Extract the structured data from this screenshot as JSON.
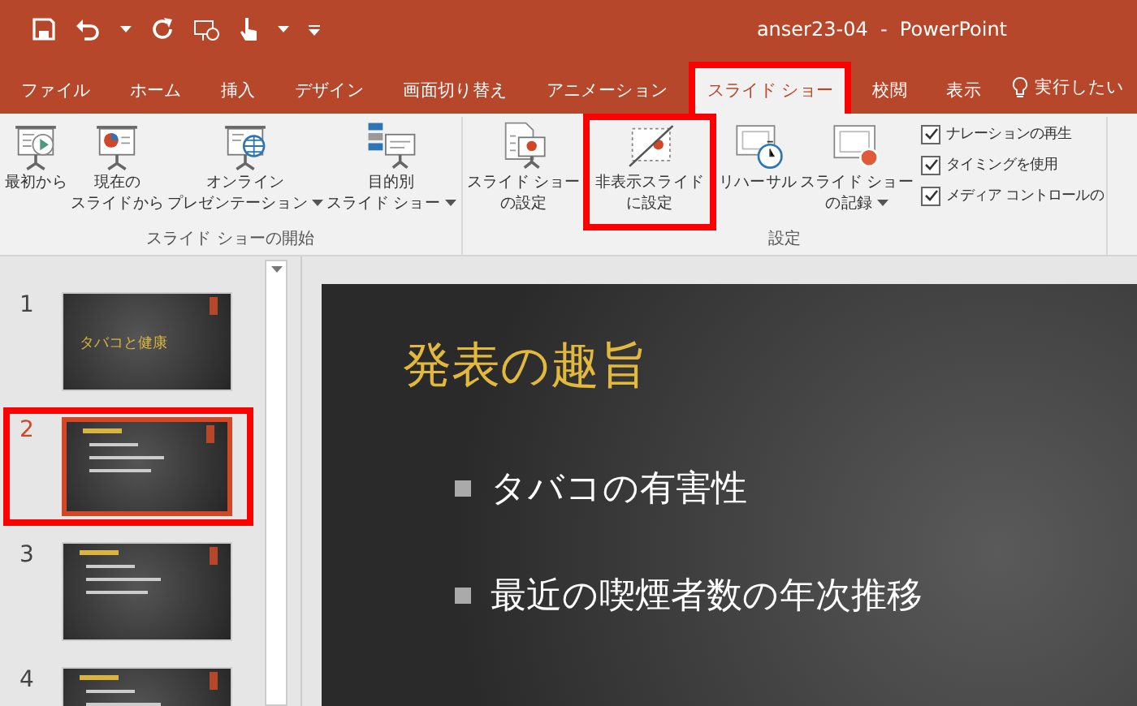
{
  "window": {
    "title": "anser23-04  -  PowerPoint"
  },
  "ribbon_tabs": [
    {
      "label": "ファイル",
      "selected": false,
      "highlighted": false
    },
    {
      "label": "ホーム",
      "selected": false,
      "highlighted": false
    },
    {
      "label": "挿入",
      "selected": false,
      "highlighted": false
    },
    {
      "label": "デザイン",
      "selected": false,
      "highlighted": false
    },
    {
      "label": "画面切り替え",
      "selected": false,
      "highlighted": false
    },
    {
      "label": "アニメーション",
      "selected": false,
      "highlighted": false
    },
    {
      "label": "スライド ショー",
      "selected": true,
      "highlighted": true
    },
    {
      "label": "校閲",
      "selected": false,
      "highlighted": false
    },
    {
      "label": "表示",
      "selected": false,
      "highlighted": false
    }
  ],
  "tell_me": "実行したい",
  "ribbon_groups": [
    {
      "label": "スライド ショーの開始",
      "buttons": [
        {
          "lines": [
            "最初から"
          ],
          "dropdown": false,
          "highlighted": false
        },
        {
          "lines": [
            "現在の",
            "スライドから"
          ],
          "dropdown": false,
          "highlighted": false
        },
        {
          "lines": [
            "オンライン",
            "プレゼンテーション"
          ],
          "dropdown": true,
          "highlighted": false
        },
        {
          "lines": [
            "目的別",
            "スライド ショー"
          ],
          "dropdown": true,
          "highlighted": false
        }
      ]
    },
    {
      "label": "設定",
      "buttons": [
        {
          "lines": [
            "スライド ショー",
            "の設定"
          ],
          "dropdown": false,
          "highlighted": false
        },
        {
          "lines": [
            "非表示スライド",
            "に設定"
          ],
          "dropdown": false,
          "highlighted": true
        },
        {
          "lines": [
            "リハーサル"
          ],
          "dropdown": false,
          "highlighted": false
        },
        {
          "lines": [
            "スライド ショー",
            "の記録"
          ],
          "dropdown": true,
          "highlighted": false
        }
      ],
      "checkboxes": [
        {
          "label": "ナレーションの再生",
          "checked": true
        },
        {
          "label": "タイミングを使用",
          "checked": true
        },
        {
          "label": "メディア コントロールの",
          "checked": true
        }
      ]
    }
  ],
  "slides": [
    {
      "number": "1",
      "selected": false,
      "highlighted": false,
      "title": "タバコと健康"
    },
    {
      "number": "2",
      "selected": true,
      "highlighted": true
    },
    {
      "number": "3",
      "selected": false,
      "highlighted": false
    },
    {
      "number": "4",
      "selected": false,
      "highlighted": false
    }
  ],
  "current_slide": {
    "title": "発表の趣旨",
    "bullets": [
      "タバコの有害性",
      "最近の喫煙者数の年次推移"
    ]
  }
}
